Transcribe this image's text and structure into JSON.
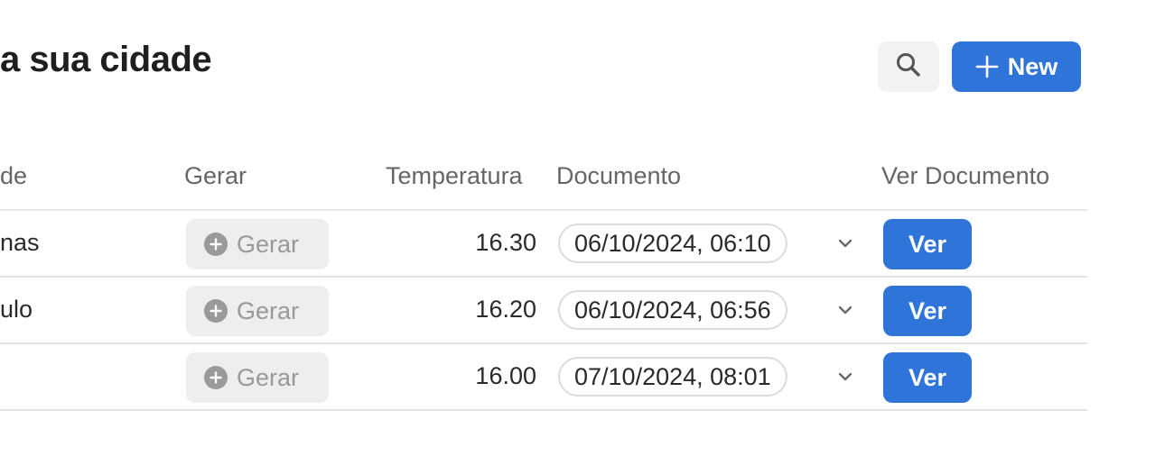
{
  "page": {
    "title": "a sua cidade"
  },
  "toolbar": {
    "search_icon": "search-icon",
    "new_label": "New",
    "new_icon": "plus-icon"
  },
  "colors": {
    "accent": "#2f75d9",
    "gerar_bg": "#eeeeee",
    "gerar_text": "#999999",
    "header_text": "#666666"
  },
  "table": {
    "headers": {
      "city": "de",
      "gerar": "Gerar",
      "temperatura": "Temperatura",
      "documento": "Documento",
      "ver_documento": "Ver Documento"
    },
    "rows": [
      {
        "city": "nas",
        "gerar_label": "Gerar",
        "temperatura": "16.30",
        "documento": "06/10/2024, 06:10",
        "ver_label": "Ver"
      },
      {
        "city": "ulo",
        "gerar_label": "Gerar",
        "temperatura": "16.20",
        "documento": "06/10/2024, 06:56",
        "ver_label": "Ver"
      },
      {
        "city": "",
        "gerar_label": "Gerar",
        "temperatura": "16.00",
        "documento": "07/10/2024, 08:01",
        "ver_label": "Ver"
      }
    ]
  }
}
